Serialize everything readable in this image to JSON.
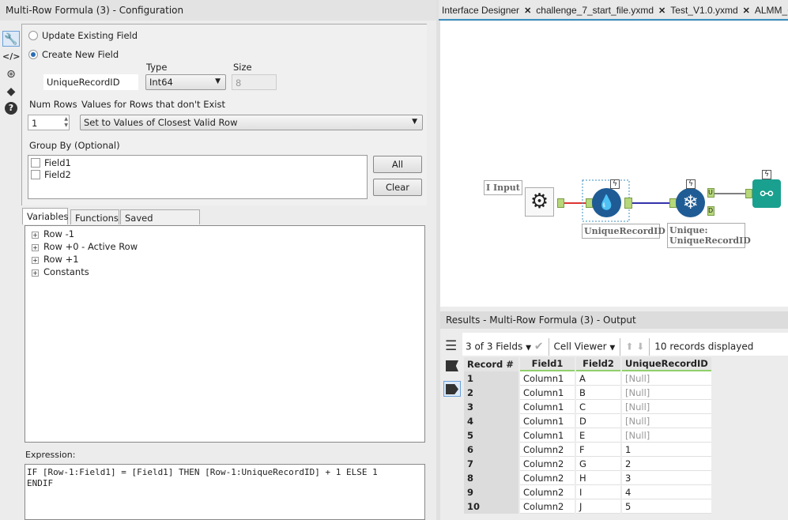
{
  "config": {
    "title": "Multi-Row Formula (3) - Configuration",
    "update_existing_label": "Update Existing Field",
    "create_new_label": "Create New  Field",
    "selected_mode": "create_new",
    "type_label": "Type",
    "size_label": "Size",
    "field_name": "UniqueRecordID",
    "type_value": "Int64",
    "size_value": "8",
    "num_rows_label": "Num Rows",
    "num_rows_value": "1",
    "missing_rows_label": "Values for Rows that don't Exist",
    "missing_rows_value": "Set to Values of Closest Valid Row",
    "group_by_label": "Group By (Optional)",
    "group_by_fields": [
      {
        "label": "Field1",
        "checked": false
      },
      {
        "label": "Field2",
        "checked": false
      }
    ],
    "all_button": "All",
    "clear_button": "Clear",
    "tabs": [
      "Variables",
      "Functions",
      "Saved Expressions"
    ],
    "active_tab": "Variables",
    "tree_items": [
      "Row -1",
      "Row +0 - Active Row",
      "Row +1",
      "Constants"
    ],
    "expression_label": "Expression:",
    "expression": "IF [Row-1:Field1] = [Field1] THEN [Row-1:UniqueRecordID] + 1 ELSE 1\nENDIF"
  },
  "sidebar_icons": [
    "wrench-icon",
    "code-icon",
    "target-icon",
    "tag-icon",
    "help-icon"
  ],
  "doc_tabs": [
    {
      "label": "Interface Designer"
    },
    {
      "label": "challenge_7_start_file.yxmd"
    },
    {
      "label": "Test_V1.0.yxmd"
    },
    {
      "label": "ALMM_C"
    }
  ],
  "canvas": {
    "input_label": "I Input",
    "multirow_label": "UniqueRecordID",
    "unique_label": "Unique: UniqueRecordID",
    "unique_anchor_u": "U",
    "unique_anchor_d": "D"
  },
  "results": {
    "title": "Results - Multi-Row Formula (3) - Output",
    "fields_selector": "3 of 3 Fields",
    "viewer": "Cell Viewer",
    "records_displayed": "10 records displayed",
    "columns": [
      "Record #",
      "Field1",
      "Field2",
      "UniqueRecordID"
    ],
    "rows": [
      [
        "1",
        "Column1",
        "A",
        "[Null]"
      ],
      [
        "2",
        "Column1",
        "B",
        "[Null]"
      ],
      [
        "3",
        "Column1",
        "C",
        "[Null]"
      ],
      [
        "4",
        "Column1",
        "D",
        "[Null]"
      ],
      [
        "5",
        "Column1",
        "E",
        "[Null]"
      ],
      [
        "6",
        "Column2",
        "F",
        "1"
      ],
      [
        "7",
        "Column2",
        "G",
        "2"
      ],
      [
        "8",
        "Column2",
        "H",
        "3"
      ],
      [
        "9",
        "Column2",
        "I",
        "4"
      ],
      [
        "10",
        "Column2",
        "J",
        "5"
      ]
    ]
  }
}
